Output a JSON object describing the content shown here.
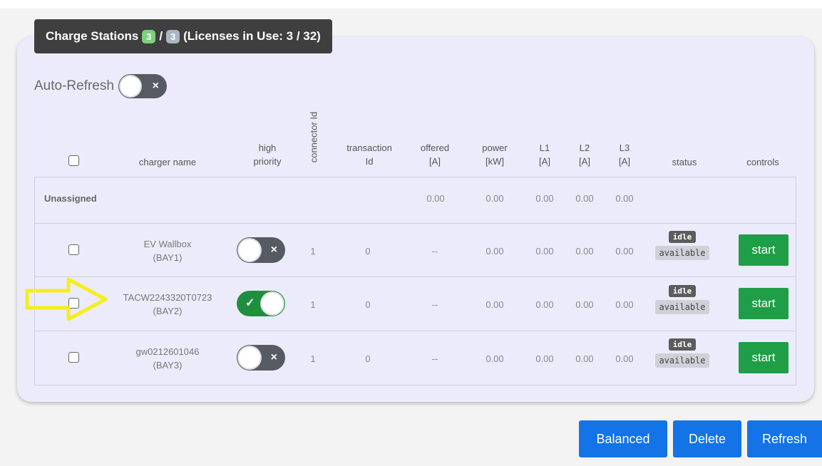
{
  "header": {
    "title": "Charge Stations",
    "active_count": "3",
    "separator": "/",
    "total_count": "3",
    "licenses": "(Licenses in Use: 3 / 32)"
  },
  "auto_refresh": {
    "label": "Auto-Refresh",
    "enabled": false
  },
  "table": {
    "headers": {
      "charger_name": "charger name",
      "high_priority": [
        "high",
        "priority"
      ],
      "connector_id": "connector Id",
      "transaction_id": [
        "transaction",
        "Id"
      ],
      "offered": [
        "offered",
        "[A]"
      ],
      "power": [
        "power",
        "[kW]"
      ],
      "l1": [
        "L1",
        "[A]"
      ],
      "l2": [
        "L2",
        "[A]"
      ],
      "l3": [
        "L3",
        "[A]"
      ],
      "status": "status",
      "controls": "controls"
    },
    "unassigned": {
      "label": "Unassigned",
      "offered": "0.00",
      "power": "0.00",
      "l1": "0.00",
      "l2": "0.00",
      "l3": "0.00"
    },
    "rows": [
      {
        "name": "EV Wallbox",
        "bay": "(BAY1)",
        "high_priority": false,
        "connector_id": "1",
        "transaction_id": "0",
        "offered": "--",
        "power": "0.00",
        "l1": "0.00",
        "l2": "0.00",
        "l3": "0.00",
        "status": "idle",
        "availability": "available",
        "control": "start"
      },
      {
        "name": "TACW2243320T0723",
        "bay": "(BAY2)",
        "high_priority": true,
        "connector_id": "1",
        "transaction_id": "0",
        "offered": "--",
        "power": "0.00",
        "l1": "0.00",
        "l2": "0.00",
        "l3": "0.00",
        "status": "idle",
        "availability": "available",
        "control": "start"
      },
      {
        "name": "gw0212601046",
        "bay": "(BAY3)",
        "high_priority": false,
        "connector_id": "1",
        "transaction_id": "0",
        "offered": "--",
        "power": "0.00",
        "l1": "0.00",
        "l2": "0.00",
        "l3": "0.00",
        "status": "idle",
        "availability": "available",
        "control": "start"
      }
    ]
  },
  "buttons": {
    "balanced": "Balanced",
    "delete": "Delete",
    "refresh": "Refresh"
  },
  "icons": {
    "toggle_off": "×",
    "toggle_on": "✓"
  },
  "colors": {
    "accent_green": "#1e9e46",
    "primary_blue": "#1473e6",
    "annotation_yellow": "#f5ee1a"
  }
}
